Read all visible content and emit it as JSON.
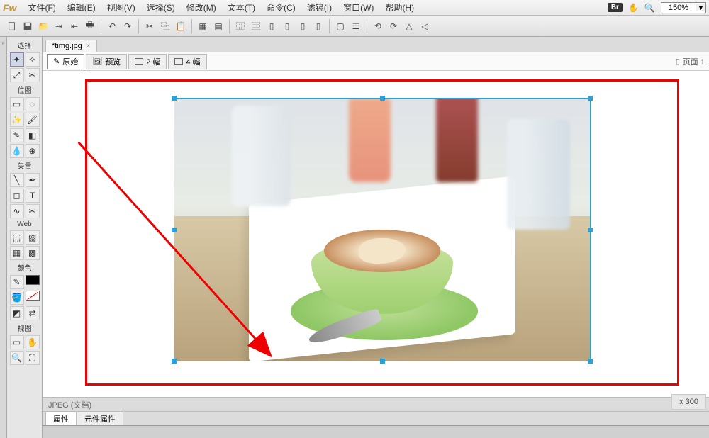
{
  "app": {
    "logo": "Fw"
  },
  "menu": {
    "file": "文件(F)",
    "edit": "编辑(E)",
    "view": "视图(V)",
    "select": "选择(S)",
    "modify": "修改(M)",
    "text": "文本(T)",
    "commands": "命令(C)",
    "filters": "滤镜(I)",
    "window": "窗口(W)",
    "help": "帮助(H)"
  },
  "menubar_right": {
    "br": "Br",
    "zoom": "150%"
  },
  "doc": {
    "tab_name": "*timg.jpg"
  },
  "viewbar": {
    "original": "原始",
    "preview": "预览",
    "two_up": "2 幅",
    "four_up": "4 幅",
    "page_label": "页面 1"
  },
  "tools": {
    "select": "选择",
    "bitmap": "位图",
    "vector": "矢量",
    "web": "Web",
    "color": "颜色",
    "view": "视图"
  },
  "status": {
    "doc_type": "JPEG (文档)",
    "dim_suffix": "x 300"
  },
  "prop": {
    "tab1": "属性",
    "tab2": "元件属性"
  }
}
